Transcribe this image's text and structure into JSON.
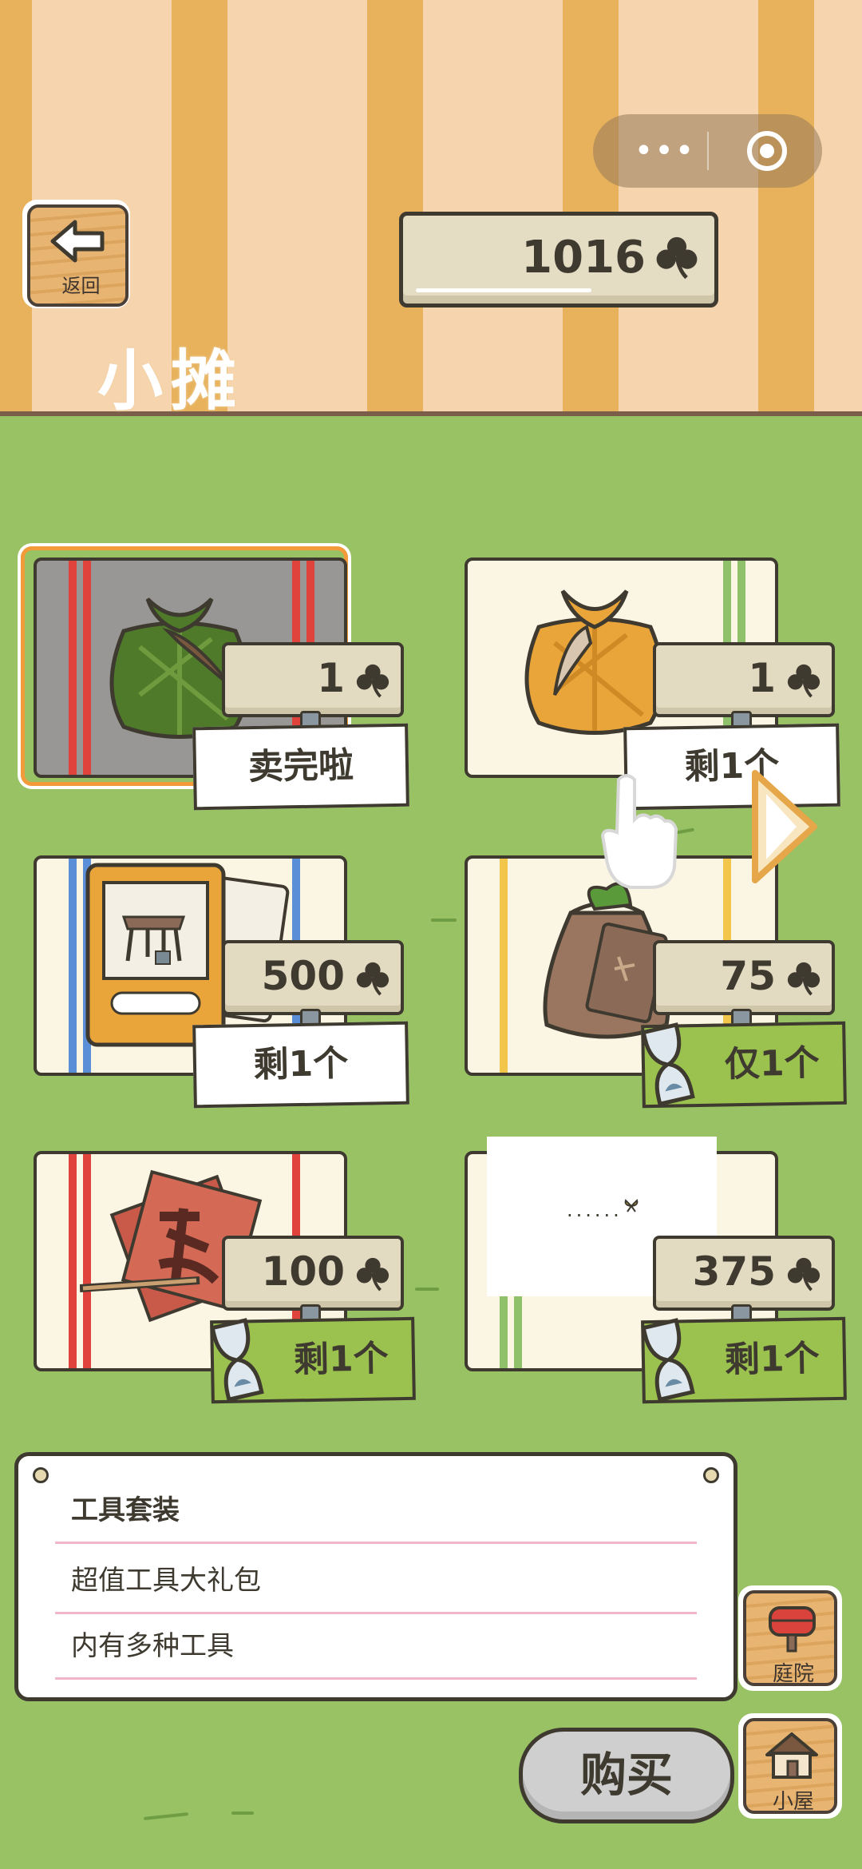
{
  "header": {
    "title": "小摊",
    "back_label": "返回",
    "currency": "1016",
    "capsule_more": "•••"
  },
  "items": [
    {
      "price": "1",
      "status": "卖完啦",
      "art": "green-bundle",
      "selected": true
    },
    {
      "price": "1",
      "status": "剩1个",
      "art": "orange-bundle",
      "selected": false
    },
    {
      "price": "500",
      "status": "剩1个",
      "art": "table-card",
      "selected": false
    },
    {
      "price": "75",
      "status": "仅1个",
      "art": "seed-bag",
      "selected": false
    },
    {
      "price": "100",
      "status": "剩1个",
      "art": "charm-paper",
      "selected": false
    },
    {
      "price": "375",
      "status": "剩1个",
      "art": "blank",
      "selected": false
    }
  ],
  "loading_text": "......",
  "description": {
    "title": "工具套装",
    "line1": "超值工具大礼包",
    "line2": "内有多种工具"
  },
  "side": {
    "yard_label": "庭院",
    "house_label": "小屋"
  },
  "buy_label": "购买",
  "colors": {
    "stripe_dark": "#e8b25c",
    "stripe_light": "#f6d4ad",
    "grass": "#98c264",
    "ink": "#3e3a30",
    "select": "#f39a3b"
  }
}
